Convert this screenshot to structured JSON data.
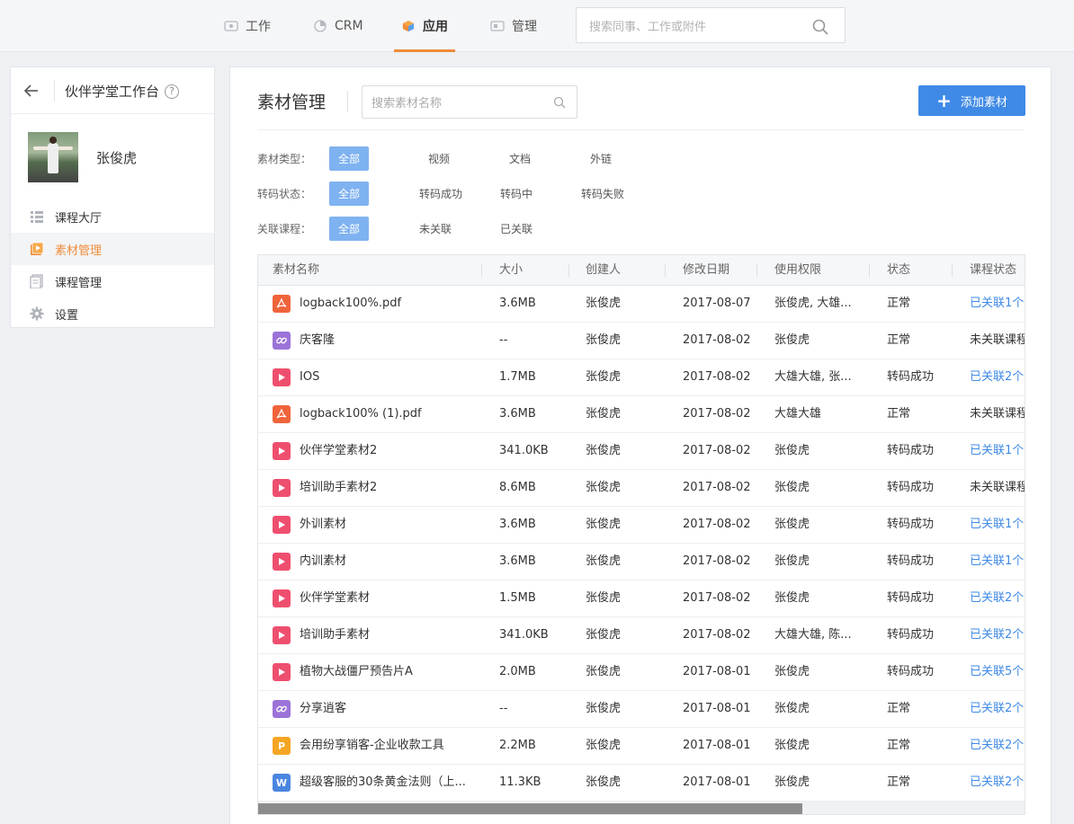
{
  "topnav": {
    "items": [
      {
        "label": "工作",
        "icon": "work-icon"
      },
      {
        "label": "CRM",
        "icon": "crm-icon"
      },
      {
        "label": "应用",
        "icon": "app-cube-icon"
      },
      {
        "label": "管理",
        "icon": "manage-icon"
      }
    ],
    "active": "应用",
    "search_placeholder": "搜索同事、工作或附件"
  },
  "sidebar": {
    "title": "伙伴学堂工作台",
    "help": "?",
    "user_name": "张俊虎",
    "items": [
      {
        "label": "课程大厅",
        "icon": "list-icon"
      },
      {
        "label": "素材管理",
        "icon": "material-icon",
        "active": true
      },
      {
        "label": "课程管理",
        "icon": "course-icon"
      },
      {
        "label": "设置",
        "icon": "gear-icon"
      }
    ]
  },
  "main": {
    "title": "素材管理",
    "search_placeholder": "搜索素材名称",
    "add_button": "添加素材",
    "filters": [
      {
        "label": "素材类型：",
        "options": [
          "全部",
          "视频",
          "文档",
          "外链"
        ]
      },
      {
        "label": "转码状态：",
        "options": [
          "全部",
          "转码成功",
          "转码中",
          "转码失败"
        ]
      },
      {
        "label": "关联课程：",
        "options": [
          "全部",
          "未关联",
          "已关联"
        ]
      }
    ],
    "table": {
      "headers": [
        "素材名称",
        "大小",
        "创建人",
        "修改日期",
        "使用权限",
        "状态",
        "课程状态"
      ],
      "rows": [
        {
          "type": "pdf",
          "icon_text": "",
          "name": "logback100%.pdf",
          "size": "3.6MB",
          "creator": "张俊虎",
          "date": "2017-08-07",
          "perm": "张俊虎, 大雄...",
          "status": "正常",
          "course": "已关联1个",
          "course_link": true
        },
        {
          "type": "link",
          "icon_text": "",
          "name": "庆客隆",
          "size": "--",
          "creator": "张俊虎",
          "date": "2017-08-02",
          "perm": "张俊虎",
          "status": "正常",
          "course": "未关联课程",
          "course_link": false
        },
        {
          "type": "video",
          "icon_text": "",
          "name": "IOS",
          "size": "1.7MB",
          "creator": "张俊虎",
          "date": "2017-08-02",
          "perm": "大雄大雄, 张...",
          "status": "转码成功",
          "course": "已关联2个",
          "course_link": true
        },
        {
          "type": "pdf",
          "icon_text": "",
          "name": "logback100% (1).pdf",
          "size": "3.6MB",
          "creator": "张俊虎",
          "date": "2017-08-02",
          "perm": "大雄大雄",
          "status": "正常",
          "course": "未关联课程",
          "course_link": false
        },
        {
          "type": "video",
          "icon_text": "",
          "name": "伙伴学堂素材2",
          "size": "341.0KB",
          "creator": "张俊虎",
          "date": "2017-08-02",
          "perm": "张俊虎",
          "status": "转码成功",
          "course": "已关联1个",
          "course_link": true
        },
        {
          "type": "video",
          "icon_text": "",
          "name": "培训助手素材2",
          "size": "8.6MB",
          "creator": "张俊虎",
          "date": "2017-08-02",
          "perm": "张俊虎",
          "status": "转码成功",
          "course": "未关联课程",
          "course_link": false
        },
        {
          "type": "video",
          "icon_text": "",
          "name": "外训素材",
          "size": "3.6MB",
          "creator": "张俊虎",
          "date": "2017-08-02",
          "perm": "张俊虎",
          "status": "转码成功",
          "course": "已关联1个",
          "course_link": true
        },
        {
          "type": "video",
          "icon_text": "",
          "name": "内训素材",
          "size": "3.6MB",
          "creator": "张俊虎",
          "date": "2017-08-02",
          "perm": "张俊虎",
          "status": "转码成功",
          "course": "已关联1个",
          "course_link": true
        },
        {
          "type": "video",
          "icon_text": "",
          "name": "伙伴学堂素材",
          "size": "1.5MB",
          "creator": "张俊虎",
          "date": "2017-08-02",
          "perm": "张俊虎",
          "status": "转码成功",
          "course": "已关联2个",
          "course_link": true
        },
        {
          "type": "video",
          "icon_text": "",
          "name": " 培训助手素材",
          "size": "341.0KB",
          "creator": "张俊虎",
          "date": "2017-08-02",
          "perm": "大雄大雄, 陈...",
          "status": "转码成功",
          "course": "已关联2个",
          "course_link": true
        },
        {
          "type": "video",
          "icon_text": "",
          "name": "植物大战僵尸预告片A",
          "size": "2.0MB",
          "creator": "张俊虎",
          "date": "2017-08-01",
          "perm": "张俊虎",
          "status": "转码成功",
          "course": "已关联5个",
          "course_link": true
        },
        {
          "type": "link",
          "icon_text": "",
          "name": "分享逍客",
          "size": "--",
          "creator": "张俊虎",
          "date": "2017-08-01",
          "perm": "张俊虎",
          "status": "正常",
          "course": "已关联2个",
          "course_link": true
        },
        {
          "type": "ppt",
          "icon_text": "P",
          "name": "会用纷享销客-企业收款工具",
          "size": "2.2MB",
          "creator": "张俊虎",
          "date": "2017-08-01",
          "perm": "张俊虎",
          "status": "正常",
          "course": "已关联2个",
          "course_link": true
        },
        {
          "type": "word",
          "icon_text": "W",
          "name": "超级客服的30条黄金法则（上...",
          "size": "11.3KB",
          "creator": "张俊虎",
          "date": "2017-08-01",
          "perm": "张俊虎",
          "status": "正常",
          "course": "已关联2个",
          "course_link": true
        }
      ]
    }
  },
  "colors": {
    "accent": "#f08c3a",
    "primary": "#3f8ae6",
    "chip_active": "#7fb2f0"
  }
}
